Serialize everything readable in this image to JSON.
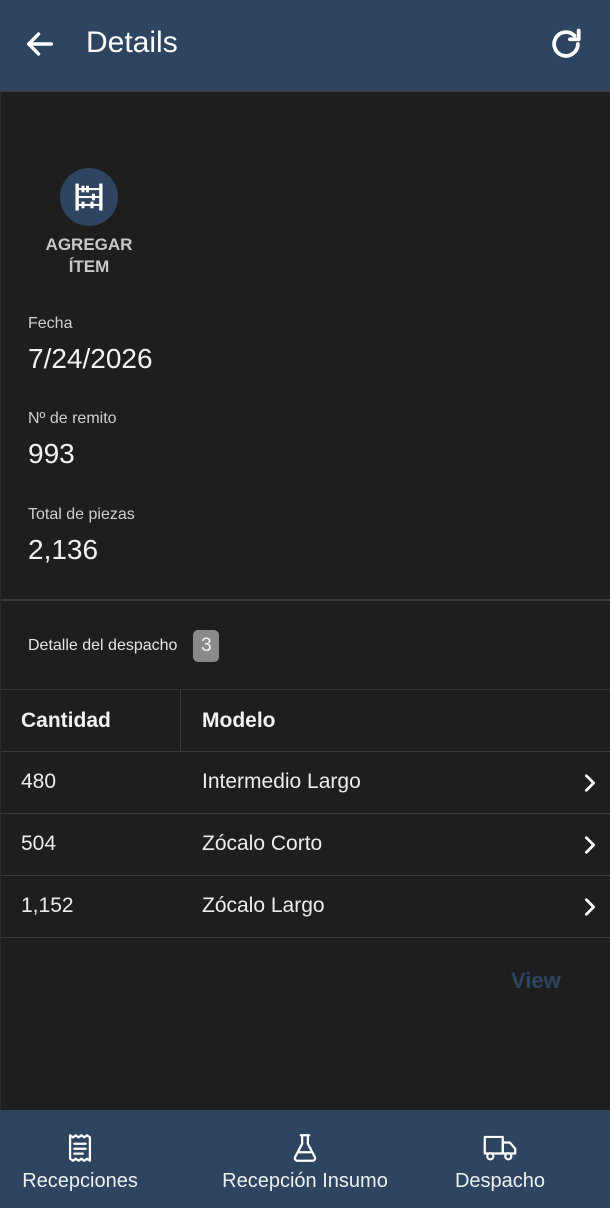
{
  "header": {
    "title": "Details",
    "back_icon": "arrow-left-icon",
    "refresh_icon": "refresh-icon"
  },
  "action": {
    "label": "AGREGAR\nÍTEM",
    "icon": "abacus-icon"
  },
  "fields": [
    {
      "label": "Fecha",
      "value": "7/24/2026"
    },
    {
      "label": "Nº de remito",
      "value": "993"
    },
    {
      "label": "Total de piezas",
      "value": "2,136"
    }
  ],
  "detail": {
    "title": "Detalle del despacho",
    "count": "3",
    "columns": [
      "Cantidad",
      "Modelo"
    ],
    "rows": [
      {
        "cantidad": "480",
        "modelo": "Intermedio Largo"
      },
      {
        "cantidad": "504",
        "modelo": "Zócalo Corto"
      },
      {
        "cantidad": "1,152",
        "modelo": "Zócalo Largo"
      }
    ]
  },
  "view_label": "View",
  "nav": [
    {
      "label": "Recepciones",
      "icon": "receipt-icon"
    },
    {
      "label": "Recepción Insumo",
      "icon": "flask-icon"
    },
    {
      "label": "Despacho",
      "icon": "truck-icon"
    }
  ],
  "colors": {
    "primary": "#2d4560",
    "background": "#1e1e1e",
    "text": "#ececec",
    "badge": "#8a8a8a"
  }
}
